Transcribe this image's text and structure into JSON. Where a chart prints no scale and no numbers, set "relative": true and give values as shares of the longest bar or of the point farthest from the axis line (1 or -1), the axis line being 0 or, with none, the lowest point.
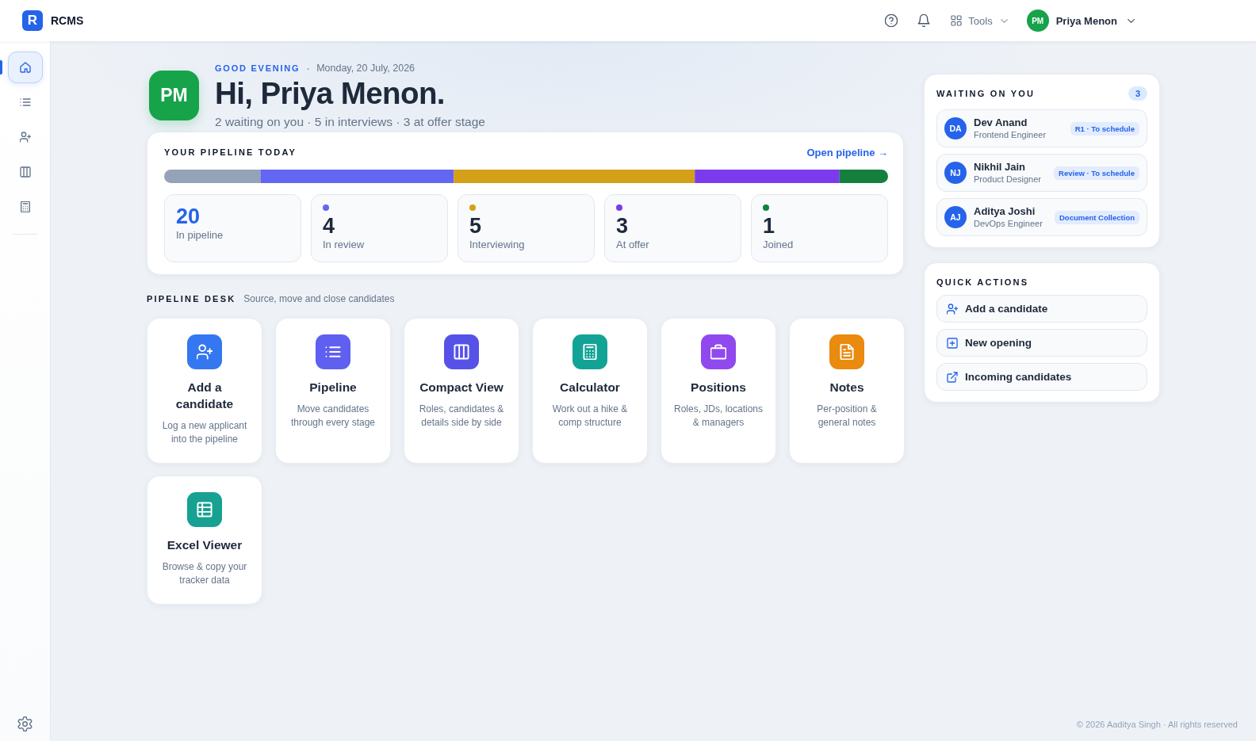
{
  "app": {
    "logo_mark": "R",
    "name": "RCMS"
  },
  "header": {
    "tools": {
      "label": "Tools"
    },
    "user": {
      "initials": "PM",
      "name": "Priya Menon"
    }
  },
  "sidebar": {
    "items": [
      {
        "selected": true
      },
      {
        "selected": false
      },
      {
        "selected": false
      },
      {
        "selected": false
      },
      {
        "selected": false
      }
    ]
  },
  "greeting": {
    "initials": "PM",
    "eyebrow": "GOOD EVENING",
    "separator": "•",
    "date": "Monday, 20 July, 2026",
    "heading": "Hi, Priya Menon.",
    "summary": "2 waiting on you · 5 in interviews · 3 at offer stage"
  },
  "pipeline": {
    "title": "YOUR PIPELINE TODAY",
    "link": "Open pipeline →",
    "chart_data": {
      "type": "bar",
      "orientation": "horizontal",
      "stacked": true,
      "relative": true,
      "series": [
        {
          "color": "#94a3b8",
          "values": [
            0.133
          ]
        },
        {
          "color": "#6366f1",
          "values": [
            0.267
          ]
        },
        {
          "color": "#d4a017",
          "values": [
            0.333
          ]
        },
        {
          "color": "#7c3aed",
          "values": [
            0.2
          ]
        },
        {
          "color": "#15803d",
          "values": [
            0.067
          ]
        }
      ]
    },
    "stats": [
      {
        "kind": "total",
        "value": "20",
        "label": "In pipeline"
      },
      {
        "kind": "stage",
        "value": "4",
        "label": "In review",
        "color": "#6366f1"
      },
      {
        "kind": "stage",
        "value": "5",
        "label": "Interviewing",
        "color": "#d4a017"
      },
      {
        "kind": "stage",
        "value": "3",
        "label": "At offer",
        "color": "#7c3aed"
      },
      {
        "kind": "stage",
        "value": "1",
        "label": "Joined",
        "color": "#15803d"
      }
    ]
  },
  "desk": {
    "title": "PIPELINE DESK",
    "subtitle": "Source, move and close candidates",
    "tiles": [
      {
        "title": "Add a candidate",
        "description": "Log a new applicant into the pipeline",
        "color": "#3477f0"
      },
      {
        "title": "Pipeline",
        "description": "Move candidates through every stage",
        "color": "#5f5ff0"
      },
      {
        "title": "Compact View",
        "description": "Roles, candidates & details side by side",
        "color": "#5652e8"
      },
      {
        "title": "Calculator",
        "description": "Work out a hike & comp structure",
        "color": "#13a396"
      },
      {
        "title": "Positions",
        "description": "Roles, JDs, locations & managers",
        "color": "#9049ee"
      },
      {
        "title": "Notes",
        "description": "Per-position & general notes",
        "color": "#ea8a0e"
      },
      {
        "title": "Excel Viewer",
        "description": "Browse & copy your tracker data",
        "color": "#16a192"
      }
    ]
  },
  "waiting": {
    "title": "WAITING ON YOU",
    "count": "3",
    "items": [
      {
        "initials": "DA",
        "name": "Dev Anand",
        "role": "Frontend Engineer",
        "tag": "R1 · To schedule"
      },
      {
        "initials": "NJ",
        "name": "Nikhil Jain",
        "role": "Product Designer",
        "tag": "Review · To schedule"
      },
      {
        "initials": "AJ",
        "name": "Aditya Joshi",
        "role": "DevOps Engineer",
        "tag": "Document Collection"
      }
    ]
  },
  "quick_actions": {
    "title": "QUICK ACTIONS",
    "items": [
      {
        "label": "Add a candidate"
      },
      {
        "label": "New opening"
      },
      {
        "label": "Incoming candidates"
      }
    ]
  },
  "footer": {
    "text": "© 2026 Aaditya Singh · All rights reserved"
  }
}
